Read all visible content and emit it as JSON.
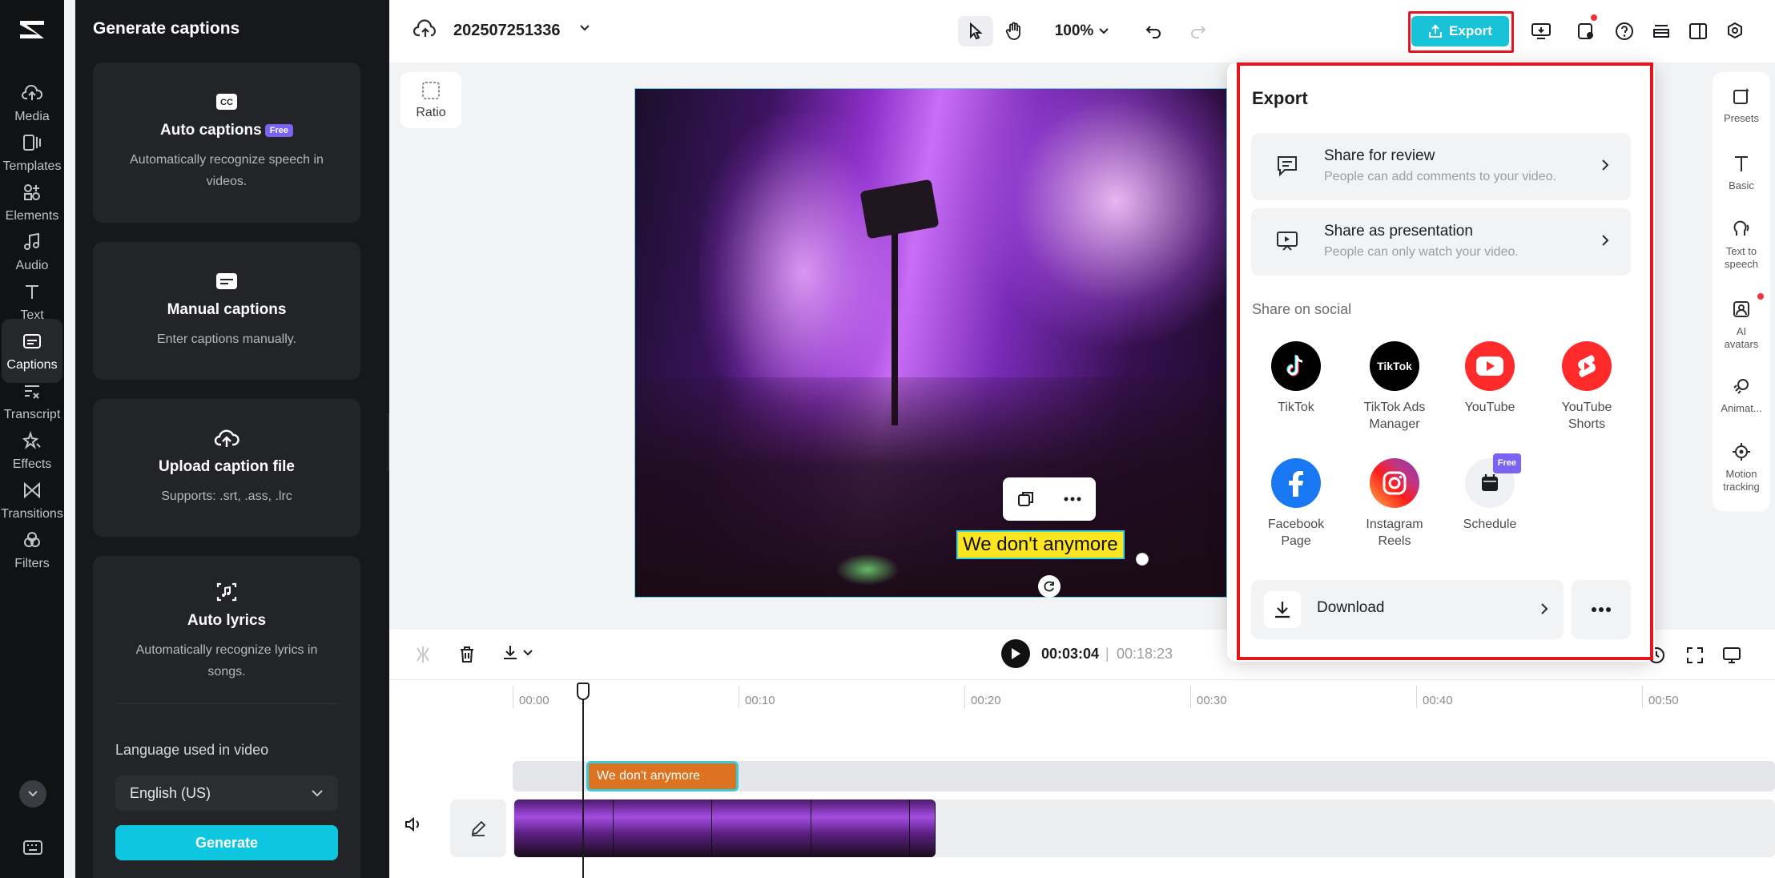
{
  "rail": {
    "items": [
      {
        "label": "Media"
      },
      {
        "label": "Templates"
      },
      {
        "label": "Elements"
      },
      {
        "label": "Audio"
      },
      {
        "label": "Text"
      },
      {
        "label": "Captions"
      },
      {
        "label": "Transcript"
      },
      {
        "label": "Effects"
      },
      {
        "label": "Transitions"
      },
      {
        "label": "Filters"
      }
    ]
  },
  "panel": {
    "title": "Generate captions",
    "cards": [
      {
        "title": "Auto captions",
        "badge": "Free",
        "desc": "Automatically recognize speech in videos."
      },
      {
        "title": "Manual captions",
        "desc": "Enter captions manually."
      },
      {
        "title": "Upload caption file",
        "desc": "Supports: .srt, .ass, .lrc"
      },
      {
        "title": "Auto lyrics",
        "desc": "Automatically recognize lyrics in songs."
      }
    ],
    "language_label": "Language used in video",
    "language_value": "English (US)",
    "generate_label": "Generate"
  },
  "topbar": {
    "project_name": "202507251336",
    "zoom": "100%",
    "export_label": "Export"
  },
  "canvas": {
    "ratio_label": "Ratio",
    "caption_text": "We don't anymore"
  },
  "right_tools": [
    {
      "label": "Presets"
    },
    {
      "label": "Basic"
    },
    {
      "label": "Text to speech"
    },
    {
      "label": "AI avatars"
    },
    {
      "label": "Animat..."
    },
    {
      "label": "Motion tracking"
    }
  ],
  "timeline": {
    "current": "00:03:04",
    "separator": "|",
    "total": "00:18:23",
    "ticks": [
      "00:00",
      "00:10",
      "00:20",
      "00:30",
      "00:40",
      "00:50"
    ],
    "text_clip": "We don't anymore"
  },
  "export_menu": {
    "title": "Export",
    "share_review": {
      "title": "Share for review",
      "desc": "People can add comments to your video."
    },
    "share_presentation": {
      "title": "Share as presentation",
      "desc": "People can only watch your video."
    },
    "social_label": "Share on social",
    "social": [
      {
        "label": "TikTok"
      },
      {
        "label": "TikTok Ads Manager"
      },
      {
        "label": "YouTube"
      },
      {
        "label": "YouTube Shorts"
      },
      {
        "label": "Facebook Page"
      },
      {
        "label": "Instagram Reels"
      },
      {
        "label": "Schedule",
        "badge": "Free"
      }
    ],
    "tiktok_ads_logo": "TikTok",
    "download_label": "Download"
  },
  "colors": {
    "accent": "#18c3d8",
    "highlight": "#e3161e",
    "caption_bg": "#fce51e",
    "text_clip": "#dd7320"
  }
}
